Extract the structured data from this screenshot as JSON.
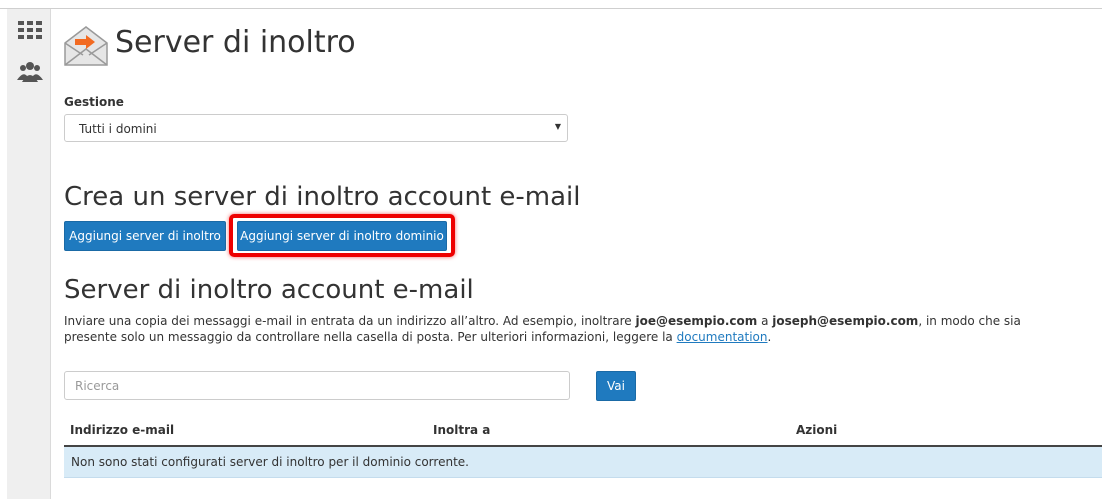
{
  "page": {
    "title": "Server di inoltro"
  },
  "sidebar": {
    "icons": [
      "grid-icon",
      "users-icon"
    ]
  },
  "management": {
    "label": "Gestione",
    "domain_select_value": "Tutti i domini"
  },
  "create_section": {
    "heading": "Crea un server di inoltro account e-mail",
    "add_forwarder_button": "Aggiungi server di inoltro",
    "add_domain_forwarder_button": "Aggiungi server di inoltro dominio"
  },
  "list_section": {
    "heading": "Server di inoltro account e-mail",
    "description_part1": "Inviare una copia dei messaggi e-mail in entrata da un indirizzo all’altro. Ad esempio, inoltrare ",
    "example_from": "joe@esempio.com",
    "description_part2": " a ",
    "example_to": "joseph@esempio.com",
    "description_part3": ", in modo che sia presente solo un messaggio da controllare nella casella di posta. Per ulteriori informazioni, leggere la ",
    "doc_link": "documentation",
    "description_end": "."
  },
  "search": {
    "placeholder": "Ricerca",
    "go_button": "Vai"
  },
  "table": {
    "columns": [
      "Indirizzo e-mail",
      "Inoltra a",
      "Azioni"
    ],
    "empty_message": "Non sono stati configurati server di inoltro per il dominio corrente."
  },
  "colors": {
    "primary_button": "#1f7abf",
    "highlight_border": "#ee0000",
    "info_row": "#d8ebf7",
    "sidebar_bg": "#efefef",
    "mail_icon_arrow": "#f26a21"
  }
}
